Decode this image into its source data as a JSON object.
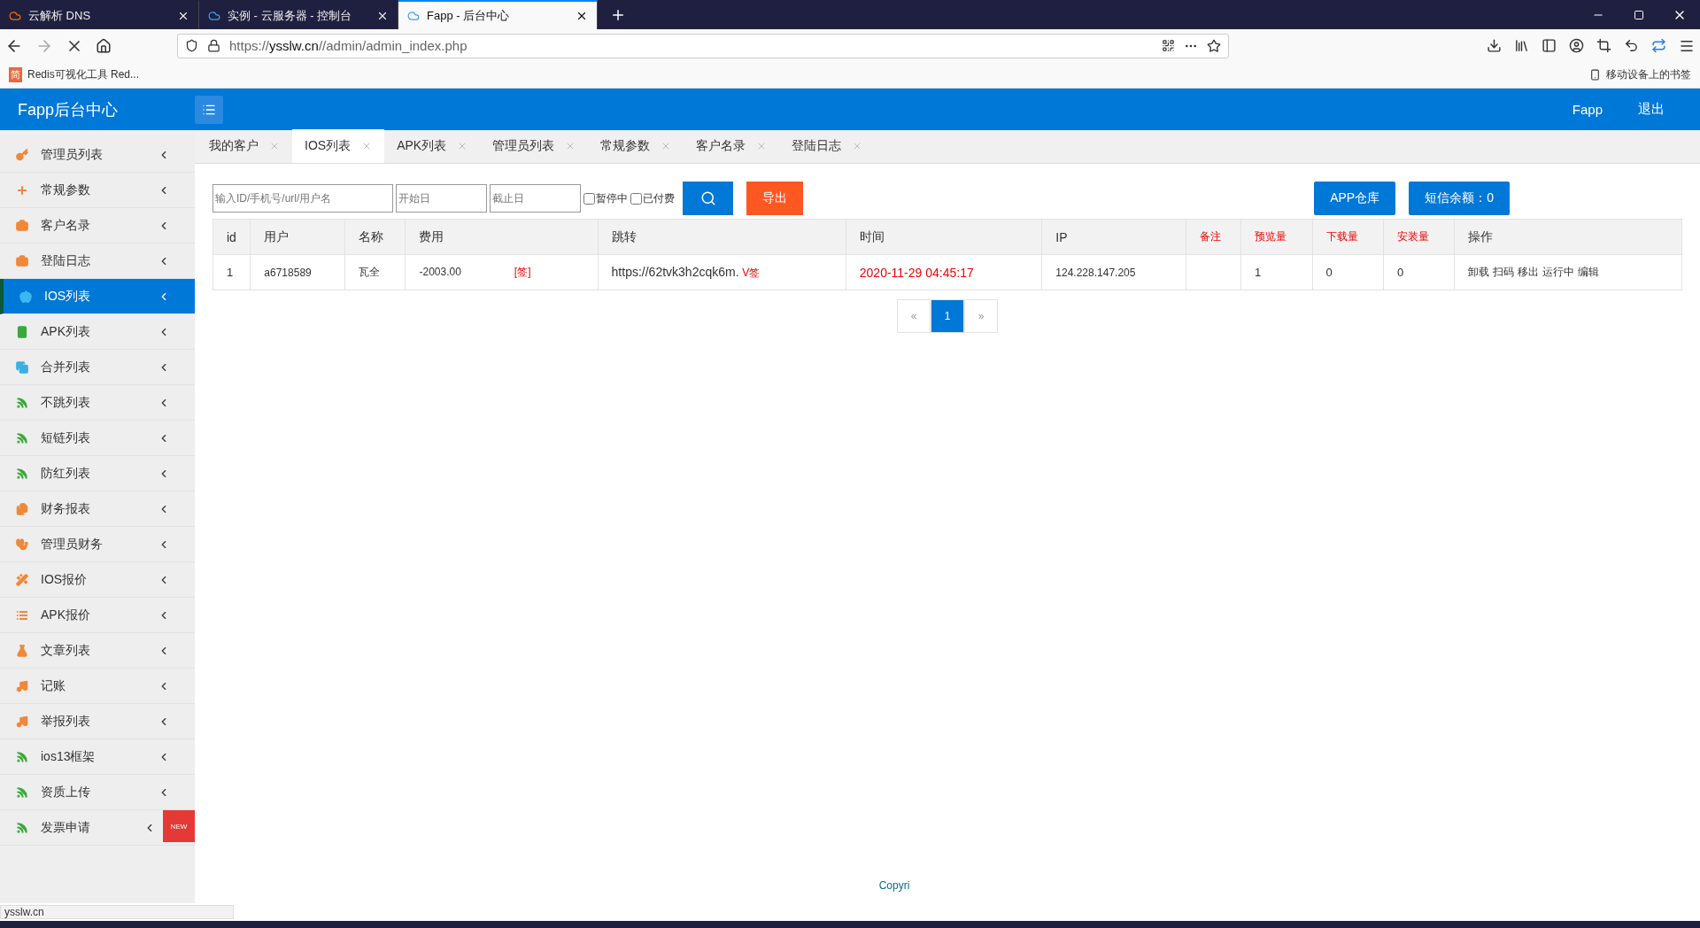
{
  "browser": {
    "tabs": [
      {
        "title": "云解析 DNS",
        "selected": false
      },
      {
        "title": "实例 - 云服务器 - 控制台",
        "selected": false
      },
      {
        "title": "Fapp - 后台中心",
        "selected": true
      }
    ],
    "url_prefix": "https://",
    "url_domain": "ysslw.cn",
    "url_path": "//admin/admin_index.php",
    "bookmarks": [
      {
        "badge": "简",
        "label": "Redis可视化工具 Red..."
      }
    ],
    "mobile_bookmarks": "移动设备上的书签"
  },
  "header": {
    "title": "Fapp后台中心",
    "user": "Fapp",
    "logout": "退出"
  },
  "sidebar": {
    "items": [
      {
        "label": "管理员列表",
        "color": "#f0883a",
        "selected": false
      },
      {
        "label": "常规参数",
        "color": "#f0883a",
        "selected": false
      },
      {
        "label": "客户名录",
        "color": "#f0883a",
        "selected": false
      },
      {
        "label": "登陆日志",
        "color": "#f0883a",
        "selected": false
      },
      {
        "label": "IOS列表",
        "color": "#3ab8f0",
        "selected": true
      },
      {
        "label": "APK列表",
        "color": "#3aa83a",
        "selected": false
      },
      {
        "label": "合并列表",
        "color": "#3ab0e0",
        "selected": false
      },
      {
        "label": "不跳列表",
        "color": "#3aa83a",
        "selected": false
      },
      {
        "label": "短链列表",
        "color": "#3aa83a",
        "selected": false
      },
      {
        "label": "防红列表",
        "color": "#3aa83a",
        "selected": false
      },
      {
        "label": "财务报表",
        "color": "#f0883a",
        "selected": false
      },
      {
        "label": "管理员财务",
        "color": "#f0883a",
        "selected": false
      },
      {
        "label": "IOS报价",
        "color": "#f0883a",
        "selected": false
      },
      {
        "label": "APK报价",
        "color": "#f0883a",
        "selected": false
      },
      {
        "label": "文章列表",
        "color": "#f0883a",
        "selected": false
      },
      {
        "label": "记账",
        "color": "#f0883a",
        "selected": false
      },
      {
        "label": "举报列表",
        "color": "#f0883a",
        "selected": false
      },
      {
        "label": "ios13框架",
        "color": "#3aa83a",
        "selected": false
      },
      {
        "label": "资质上传",
        "color": "#3aa83a",
        "selected": false
      },
      {
        "label": "发票申请",
        "color": "#3aa83a",
        "selected": false,
        "badge": "NEW"
      }
    ]
  },
  "page_tabs": [
    {
      "label": "我的客户",
      "selected": false
    },
    {
      "label": "IOS列表",
      "selected": true
    },
    {
      "label": "APK列表",
      "selected": false
    },
    {
      "label": "管理员列表",
      "selected": false
    },
    {
      "label": "常规参数",
      "selected": false
    },
    {
      "label": "客户名录",
      "selected": false
    },
    {
      "label": "登陆日志",
      "selected": false
    }
  ],
  "filters": {
    "search": {
      "placeholder": "输入ID/手机号/url/用户名"
    },
    "start": {
      "placeholder": "开始日"
    },
    "end": {
      "placeholder": "截止日"
    },
    "checks": [
      {
        "label": "暂停中",
        "checked": false
      },
      {
        "label": "已付费",
        "checked": false
      }
    ],
    "export": "导出",
    "warehouse": "APP仓库",
    "sms": "短信余额：0"
  },
  "table": {
    "columns": [
      {
        "label": "id",
        "highlight": false
      },
      {
        "label": "用户",
        "highlight": false
      },
      {
        "label": "名称",
        "highlight": false
      },
      {
        "label": "费用",
        "highlight": false
      },
      {
        "label": "跳转",
        "highlight": false
      },
      {
        "label": "时间",
        "highlight": false
      },
      {
        "label": "IP",
        "highlight": false
      },
      {
        "label": "备注",
        "highlight": true
      },
      {
        "label": "预览量",
        "highlight": true
      },
      {
        "label": "下载量",
        "highlight": true
      },
      {
        "label": "安装量",
        "highlight": true
      },
      {
        "label": "操作",
        "highlight": false
      }
    ],
    "rows": [
      {
        "id": "1",
        "user": "a6718589",
        "name": "瓦全",
        "fee": "-2003.00",
        "fee_tag": "[签]",
        "jump": "https://62tvk3h2cqk6m.",
        "jump_tag": "V签",
        "time": "2020-11-29 04:45:17",
        "ip": "124.228.147.205",
        "note": "",
        "preview": "1",
        "download": "0",
        "install": "0",
        "actions": [
          "卸载",
          "扫码",
          "移出",
          "运行中",
          "编辑"
        ]
      }
    ]
  },
  "pagination": {
    "prev": "«",
    "pages": [
      {
        "label": "1",
        "selected": true
      }
    ],
    "next": "»"
  },
  "footer": "Copyri",
  "status_url": "ysslw.cn"
}
